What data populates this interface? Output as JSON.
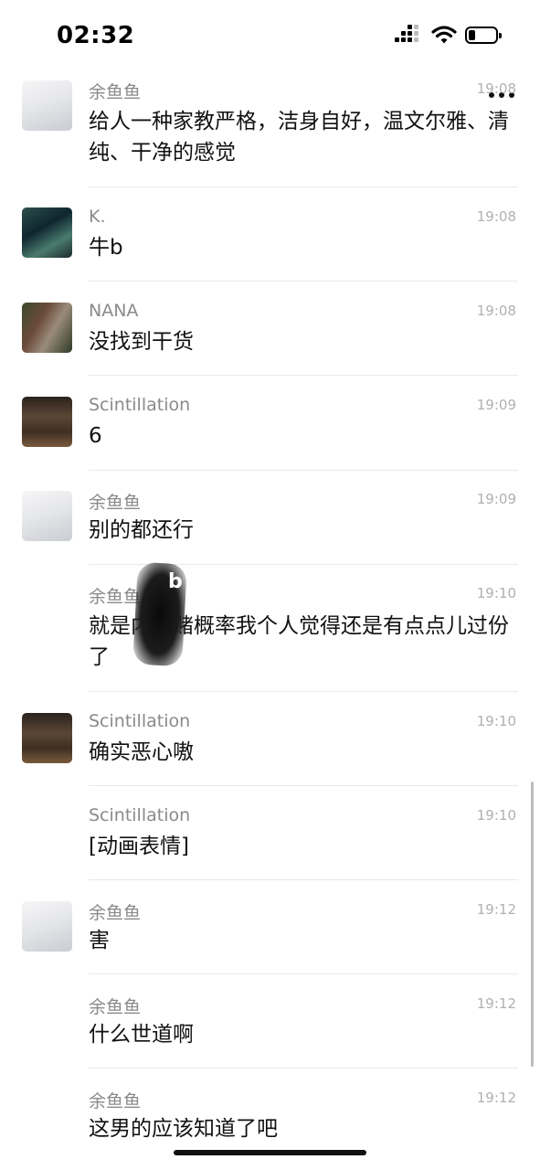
{
  "status_bar": {
    "time": "02:32"
  },
  "messages": [
    {
      "sender": "余鱼鱼",
      "time": "19:08",
      "text": "给人一种家教严格，洁身自好，温文尔雅、清纯、干净的感觉"
    },
    {
      "sender": "K.",
      "time": "19:08",
      "text": "牛b"
    },
    {
      "sender": "NANA",
      "time": "19:08",
      "text": "没找到干货"
    },
    {
      "sender": "Scintillation",
      "time": "19:09",
      "text": "6"
    },
    {
      "sender": "余鱼鱼",
      "time": "19:09",
      "text": "别的都还行"
    },
    {
      "sender": "余鱼鱼",
      "time": "19:10",
      "text": "就是内射赌概率我个人觉得还是有点点儿过份了"
    },
    {
      "sender": "Scintillation",
      "time": "19:10",
      "text": "确实恶心嗷"
    },
    {
      "sender": "Scintillation",
      "time": "19:10",
      "text": "[动画表情]"
    },
    {
      "sender": "余鱼鱼",
      "time": "19:12",
      "text": "害"
    },
    {
      "sender": "余鱼鱼",
      "time": "19:12",
      "text": "什么世道啊"
    },
    {
      "sender": "余鱼鱼",
      "time": "19:12",
      "text": "这男的应该知道了吧"
    }
  ],
  "overlay": {
    "smudge_letter": "b"
  },
  "icons": {
    "back": "chevron-left-icon",
    "more": "more-dots-icon"
  }
}
